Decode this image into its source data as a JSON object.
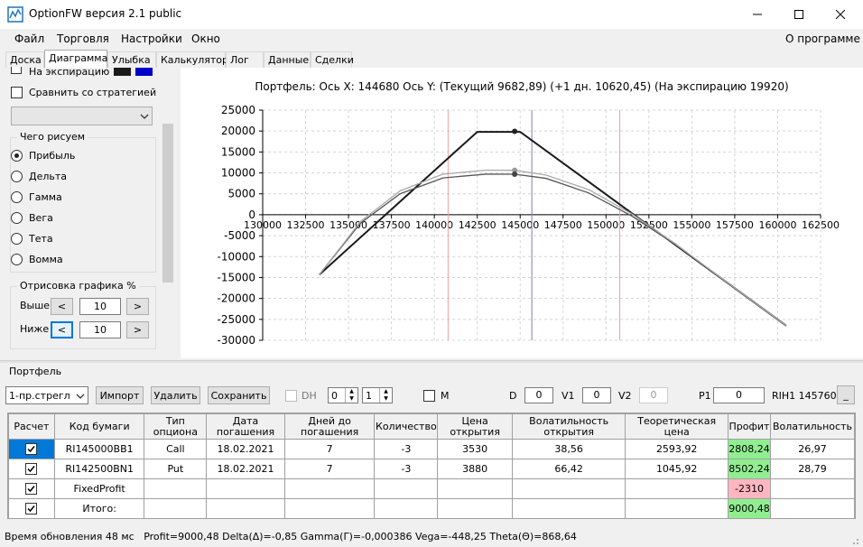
{
  "window": {
    "title": "OptionFW версия 2.1 public",
    "controls": [
      "minimize",
      "maximize",
      "close"
    ]
  },
  "menu": {
    "items": [
      "Файл",
      "Торговля",
      "Настройки",
      "Окно"
    ],
    "about": "О программе"
  },
  "tabs": [
    {
      "label": "Доска",
      "active": false
    },
    {
      "label": "Диаграмма",
      "active": true
    },
    {
      "label": "Улыбка",
      "active": false
    },
    {
      "label": "Калькулятор",
      "active": false
    },
    {
      "label": "Лог",
      "active": false
    },
    {
      "label": "Данные",
      "active": false
    },
    {
      "label": "Сделки",
      "active": false
    }
  ],
  "left": {
    "expiration_label": "На экспирацию",
    "expiration_colors": [
      "#1a1a1a",
      "#0000cc"
    ],
    "compare_label": "Сравнить со стратегией",
    "compare_checked": false,
    "what_title": "Чего рисуем",
    "what_options": [
      "Прибыль",
      "Дельта",
      "Гамма",
      "Вега",
      "Тета",
      "Вомма"
    ],
    "what_selected": 0,
    "render_title": "Отрисовка графика %",
    "above_label": "Выше",
    "above_value": "10",
    "below_label": "Ниже",
    "below_value": "10"
  },
  "chart": {
    "header": "Портфель: Ось X:  144680 Ось Y:   (Текущий 9682,89)   (+1 дн.  10620,45)   (На экспирацию  19920)",
    "chart_data": {
      "type": "line",
      "xlim": [
        130000,
        162500
      ],
      "ylim": [
        -30000,
        25000
      ],
      "xticks": [
        130000,
        132500,
        135000,
        137500,
        140000,
        142500,
        145000,
        147500,
        150000,
        152500,
        155000,
        157500,
        160000,
        162500
      ],
      "yticks": [
        25000,
        20000,
        15000,
        10000,
        5000,
        0,
        -5000,
        -10000,
        -15000,
        -20000,
        -25000,
        -30000
      ],
      "grid": true,
      "current_x": 145680,
      "pink_lines": [
        140800,
        150800
      ],
      "series": [
        {
          "color": "#1a1a1a",
          "x": [
            133300,
            142500,
            145000,
            160500
          ],
          "y": [
            -14300,
            19800,
            19800,
            -26500
          ]
        },
        {
          "color": "#555555",
          "x": [
            133300,
            135700,
            138000,
            140500,
            143000,
            144680,
            146500,
            149000,
            151500,
            154000,
            157000,
            160500
          ],
          "y": [
            -14300,
            -2000,
            5000,
            8800,
            9700,
            9683,
            8700,
            5200,
            -300,
            -7000,
            -16000,
            -26500
          ]
        },
        {
          "color": "#aaaaaa",
          "x": [
            133300,
            135700,
            138000,
            140500,
            143000,
            144680,
            146500,
            149000,
            151500,
            154000,
            157000,
            160500
          ],
          "y": [
            -14300,
            -1600,
            5700,
            9700,
            10650,
            10620,
            9500,
            6000,
            200,
            -6800,
            -16000,
            -26500
          ]
        }
      ],
      "markers": [
        {
          "x": 144680,
          "y": 19920,
          "color": "#222222"
        },
        {
          "x": 144680,
          "y": 10620,
          "color": "#999999"
        },
        {
          "x": 144680,
          "y": 9683,
          "color": "#444444"
        }
      ]
    }
  },
  "portfolio": {
    "title": "Портфель",
    "strategy": "1-пр.стрегл",
    "buttons": {
      "import": "Импорт",
      "delete": "Удалить",
      "save": "Сохранить"
    },
    "dh_label": "DH",
    "spin1": "0",
    "spin2": "1",
    "m_label": "M",
    "d_label": "D",
    "d_value": "0",
    "v1_label": "V1",
    "v1_value": "0",
    "v2_label": "V2",
    "v2_value": "0",
    "p1_label": "P1",
    "p1_value": "0",
    "instrument": "RIH1 145760",
    "small_btn": "_",
    "columns": [
      "Расчет",
      "Код бумаги",
      "Тип опциона",
      "Дата погашения",
      "Дней до погашения",
      "Количество",
      "Цена открытия",
      "Волатильность открытия",
      "Теоретическая цена",
      "Профит",
      "Волатильность"
    ],
    "rows": [
      {
        "code": "RI145000BB1",
        "type": "Call",
        "date": "18.02.2021",
        "days": "7",
        "qty": "-3",
        "price": "3530",
        "vol_open": "38,56",
        "theo": "2593,92",
        "profit": "2808,24",
        "vol": "26,97",
        "profit_color": "#90ee90",
        "selected": true
      },
      {
        "code": "RI142500BN1",
        "type": "Put",
        "date": "18.02.2021",
        "days": "7",
        "qty": "-3",
        "price": "3880",
        "vol_open": "66,42",
        "theo": "1045,92",
        "profit": "8502,24",
        "vol": "28,79",
        "profit_color": "#90ee90",
        "selected": false
      },
      {
        "code": "FixedProfit",
        "type": "",
        "date": "",
        "days": "",
        "qty": "",
        "price": "",
        "vol_open": "",
        "theo": "",
        "profit": "-2310",
        "vol": "",
        "profit_color": "#ffb6c1",
        "selected": false
      },
      {
        "code": "Итого:",
        "type": "",
        "date": "",
        "days": "",
        "qty": "",
        "price": "",
        "vol_open": "",
        "theo": "",
        "profit": "9000,48",
        "vol": "",
        "profit_color": "#90ee90",
        "selected": false
      }
    ]
  },
  "status": "Время обновления 48 мс   Profit=9000,48 Delta(Δ)=-0,85 Gamma(Γ)=-0,000386 Vega=-448,25 Theta(Θ)=868,64"
}
